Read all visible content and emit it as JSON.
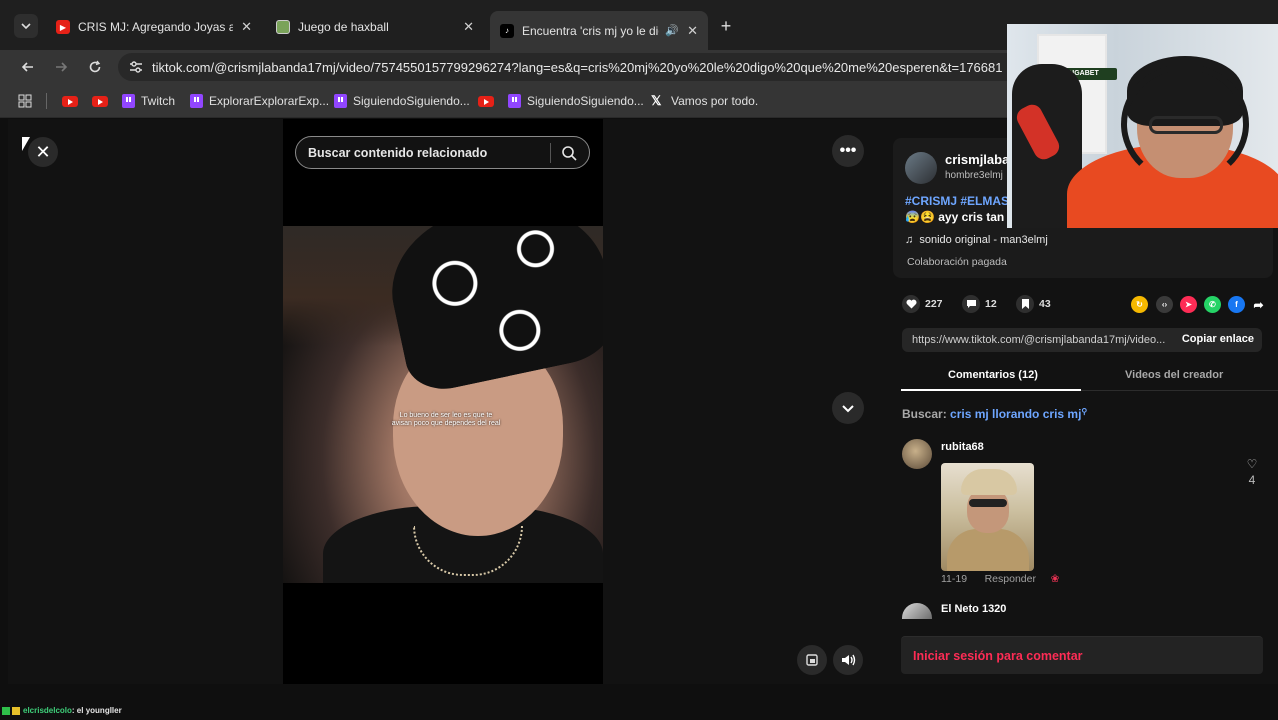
{
  "browser": {
    "tabs": [
      {
        "title": "CRIS MJ: Agregando Joyas a la",
        "favicon": "youtube-icon"
      },
      {
        "title": "Juego de haxball",
        "favicon": "haxball-icon"
      },
      {
        "title": "Encuentra 'cris mj yo le dig",
        "favicon": "tiktok-icon"
      }
    ],
    "url": "tiktok.com/@crismjlabanda17mj/video/7574550157799296274?lang=es&q=cris%20mj%20yo%20le%20digo%20que%20me%20esperen&t=176681",
    "bookmarks": [
      "Twitch",
      "ExplorarExplorarExp...",
      "SiguiendoSiguiendo...",
      "SiguiendoSiguiendo...",
      "Vamos por todo."
    ]
  },
  "player": {
    "search_placeholder": "Buscar contenido relacionado",
    "caption": "Lo bueno de ser leo es que te avisan poco que dependes del real"
  },
  "video_info": {
    "author": "crismjlabanda17mj",
    "handle": "hombre3elmj",
    "hashtags": "#CRISMJ #ELMAS",
    "description": "😰😫 ayy cris tan",
    "sound": "sonido original - man3elmj",
    "paid_label": "Colaboración pagada"
  },
  "stats": {
    "likes": "227",
    "comments": "12",
    "saves": "43"
  },
  "share": {
    "link": "https://www.tiktok.com/@crismjlabanda17mj/video...",
    "copy_label": "Copiar enlace"
  },
  "panel_tabs": {
    "comments": "Comentarios (12)",
    "creator_videos": "Videos del creador"
  },
  "search_hint": {
    "label": "Buscar:",
    "query": "cris mj llorando cris mj"
  },
  "comments": [
    {
      "user": "rubita68",
      "date": "11-19",
      "reply": "Responder",
      "likes": "4"
    },
    {
      "user": "El Neto 1320"
    }
  ],
  "login_cta": "Iniciar sesión para comentar",
  "webcam": {
    "sponsor": "JUGABET"
  },
  "chat": {
    "user": "elcrisdelcolo",
    "message": ": el youngller"
  },
  "colors": {
    "accent": "#fe2c55",
    "link": "#6ea6ff",
    "background": "#121212"
  }
}
